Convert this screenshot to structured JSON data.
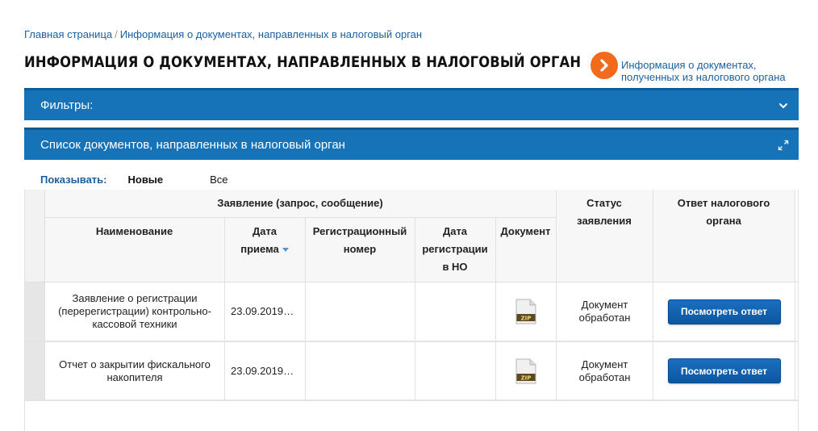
{
  "breadcrumb": {
    "home": "Главная страница",
    "separator": "/",
    "current": "Информация о документах, направленных в налоговый орган"
  },
  "page_title": "ИНФОРМАЦИЯ О ДОКУМЕНТАХ, НАПРАВЛЕННЫХ В НАЛОГОВЫЙ ОРГАН",
  "side_link": {
    "line1": "Информация о документах,",
    "line2": "полученных из налогового органа",
    "icon": "arrow-right-circle-icon",
    "color": "#f26a1b"
  },
  "filters_bar": {
    "label": "Фильтры:",
    "icon": "chevron-down-icon"
  },
  "list_bar": {
    "label": "Список документов, направленных в налоговый орган",
    "icon": "expand-icon"
  },
  "show": {
    "label": "Показывать:",
    "options": [
      "Новые",
      "Все"
    ],
    "selected": "Новые"
  },
  "table": {
    "group_header": "Заявление (запрос, сообщение)",
    "columns": {
      "name": "Наименование",
      "date_line1": "Дата",
      "date_line2": "приема",
      "reg_line1": "Регистрационный",
      "reg_line2": "номер",
      "regdate_line1": "Дата",
      "regdate_line2": "регистрации",
      "regdate_line3": "в НО",
      "document": "Документ",
      "status_line1": "Статус",
      "status_line2": "заявления",
      "answer_line1": "Ответ налогового",
      "answer_line2": "органа"
    },
    "rows": [
      {
        "name_lines": [
          "Заявление о регистрации",
          "(перерегистрации) контрольно-",
          "кассовой техники"
        ],
        "date": "23.09.2019…",
        "reg_number": "",
        "reg_date": "",
        "file_label": "ZIP",
        "status_lines": [
          "Документ",
          "обработан"
        ],
        "button": "Посмотреть ответ"
      },
      {
        "name_lines": [
          "Отчет о закрытии фискального",
          "накопителя"
        ],
        "date": "23.09.2019…",
        "reg_number": "",
        "reg_date": "",
        "file_label": "ZIP",
        "status_lines": [
          "Документ",
          "обработан"
        ],
        "button": "Посмотреть ответ"
      }
    ]
  },
  "colors": {
    "accent": "#1673b8",
    "link": "#1a5f9e",
    "button": "#0d56a0"
  }
}
